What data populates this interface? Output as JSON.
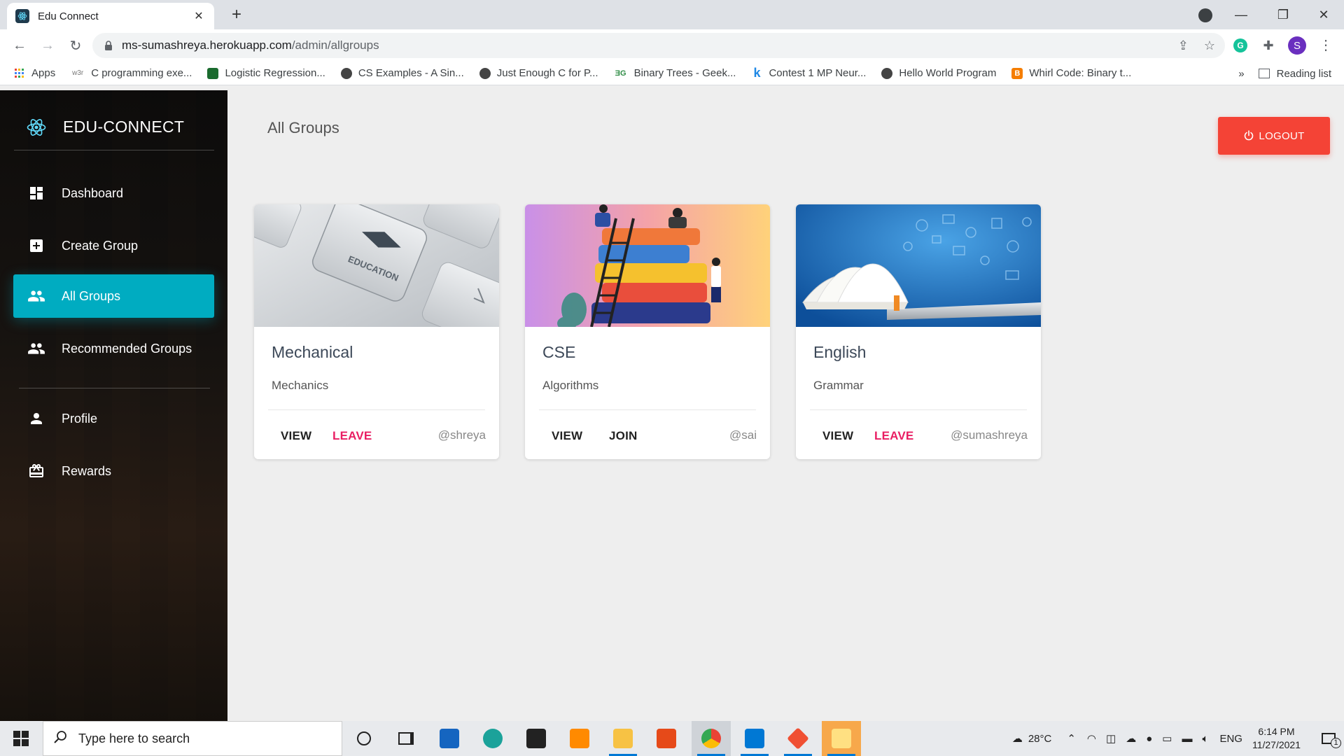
{
  "browser": {
    "tab_title": "Edu Connect",
    "new_tab": "+",
    "url_host": "ms-sumashreya.herokuapp.com",
    "url_path": "/admin/allgroups",
    "profile_initial": "S",
    "bookmarks": [
      {
        "label": "Apps",
        "icon": "apps-grid-icon"
      },
      {
        "label": "C programming exe...",
        "icon": "w3r-icon",
        "glyph": "w3r"
      },
      {
        "label": "Logistic Regression...",
        "icon": "green-doc-icon"
      },
      {
        "label": "CS Examples - A Sin...",
        "icon": "globe-icon"
      },
      {
        "label": "Just Enough C for P...",
        "icon": "globe-icon"
      },
      {
        "label": "Binary Trees - Geek...",
        "icon": "gfg-icon",
        "glyph": "ƎG"
      },
      {
        "label": "Contest 1 MP Neur...",
        "icon": "k-icon",
        "glyph": "k"
      },
      {
        "label": "Hello World Program",
        "icon": "globe-icon"
      },
      {
        "label": "Whirl Code: Binary t...",
        "icon": "blogger-icon",
        "glyph": "B"
      }
    ],
    "more_bookmarks": "»",
    "reading_list": "Reading list"
  },
  "sidebar": {
    "brand": "EDU-CONNECT",
    "items": [
      {
        "label": "Dashboard",
        "icon": "dashboard-icon",
        "active": false
      },
      {
        "label": "Create Group",
        "icon": "add-box-icon",
        "active": false
      },
      {
        "label": "All Groups",
        "icon": "people-icon",
        "active": true
      },
      {
        "label": "Recommended Groups",
        "icon": "people-icon",
        "active": false
      },
      {
        "label": "Profile",
        "icon": "person-icon",
        "active": false
      },
      {
        "label": "Rewards",
        "icon": "card-giftcard-icon",
        "active": false
      }
    ]
  },
  "main": {
    "title": "All Groups",
    "logout_label": "LOGOUT",
    "cards": [
      {
        "title": "Mechanical",
        "subtitle": "Mechanics",
        "view": "VIEW",
        "action": "LEAVE",
        "action_type": "leave",
        "owner": "@shreya",
        "image": "education-key-image"
      },
      {
        "title": "CSE",
        "subtitle": "Algorithms",
        "view": "VIEW",
        "action": "JOIN",
        "action_type": "join",
        "owner": "@sai",
        "image": "stacked-books-image"
      },
      {
        "title": "English",
        "subtitle": "Grammar",
        "view": "VIEW",
        "action": "LEAVE",
        "action_type": "leave",
        "owner": "@sumashreya",
        "image": "book-laptop-image"
      }
    ]
  },
  "taskbar": {
    "search_placeholder": "Type here to search",
    "weather": "28°C",
    "language": "ENG",
    "time": "6:14 PM",
    "date": "11/27/2021",
    "notification_count": "1"
  },
  "colors": {
    "active_menu": "#00acc1",
    "logout": "#f44336",
    "leave": "#e91e63"
  }
}
